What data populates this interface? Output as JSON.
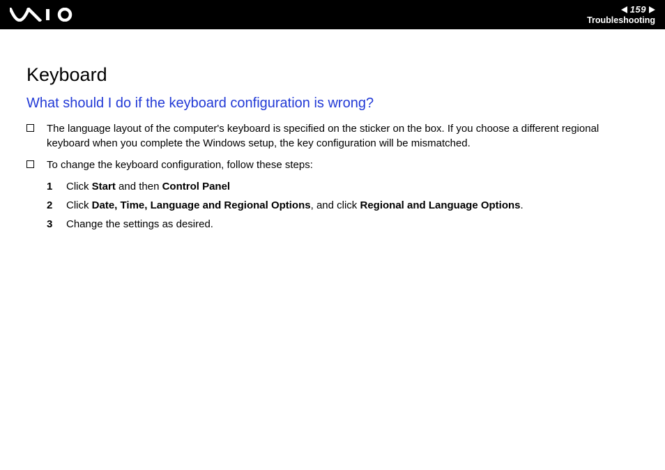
{
  "header": {
    "page_number": "159",
    "section": "Troubleshooting"
  },
  "content": {
    "h1": "Keyboard",
    "h2": "What should I do if the keyboard configuration is wrong?",
    "bullet1": "The language layout of the computer's keyboard is specified on the sticker on the box. If you choose a different regional keyboard when you complete the Windows setup, the key configuration will be mismatched.",
    "bullet2": "To change the keyboard configuration, follow these steps:",
    "steps": {
      "s1_pre": "Click ",
      "s1_b1": "Start",
      "s1_mid": " and then ",
      "s1_b2": "Control Panel",
      "s2_pre": "Click ",
      "s2_b1": "Date, Time, Language and Regional Options",
      "s2_mid": ", and click ",
      "s2_b2": "Regional and Language Options",
      "s2_post": ".",
      "s3": "Change the settings as desired.",
      "n1": "1",
      "n2": "2",
      "n3": "3"
    }
  }
}
